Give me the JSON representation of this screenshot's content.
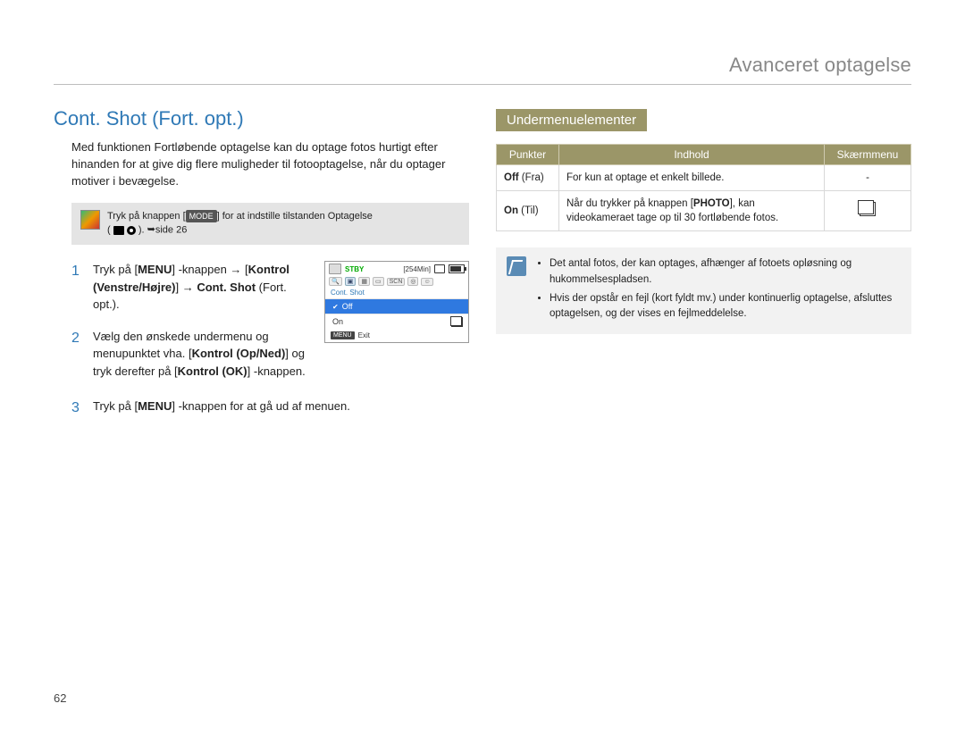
{
  "header": {
    "title": "Avanceret optagelse"
  },
  "section": {
    "title": "Cont. Shot (Fort. opt.)",
    "intro": "Med funktionen Fortløbende optagelse kan du optage fotos hurtigt efter hinanden for at give dig flere muligheder til fotooptagelse, når du optager motiver i bevægelse."
  },
  "note": {
    "pre": "Tryk på knappen [",
    "mode": "MODE",
    "mid": "] for at indstille tilstanden Optagelse",
    "line2_prefix": "( ",
    "line2_suffix": " ). ",
    "page_ref": "side 26"
  },
  "steps": [
    {
      "num": "1",
      "parts": {
        "a": "Tryk på [",
        "b": "MENU",
        "c": "] -knappen ",
        "d": "[",
        "e": "Kontrol (Venstre/Højre)",
        "f": "] ",
        "g": "Cont. Shot",
        "h": " (Fort. opt.)."
      }
    },
    {
      "num": "2",
      "parts": {
        "a": "Vælg den ønskede undermenu og menupunktet vha. [",
        "b": "Kontrol (Op/Ned)",
        "c": "] og tryk derefter på [",
        "d": "Kontrol (OK)",
        "e": "] -knappen."
      }
    },
    {
      "num": "3",
      "parts": {
        "a": "Tryk på [",
        "b": "MENU",
        "c": "] -knappen for at gå ud af menuen."
      }
    }
  ],
  "screen": {
    "stby": "STBY",
    "time": "[254Min]",
    "menu_title": "Cont. Shot",
    "row_off": "Off",
    "row_on": "On",
    "footer_chip": "MENU",
    "footer_text": "Exit"
  },
  "submenu": {
    "title": "Undermenuelementer",
    "headers": {
      "points": "Punkter",
      "content": "Indhold",
      "screen": "Skærmmenu"
    },
    "rows": [
      {
        "point_bold": "Off",
        "point_paren": " (Fra)",
        "content": "For kun at optage et enkelt billede.",
        "screen_dash": "-"
      },
      {
        "point_bold": "On",
        "point_paren": " (Til)",
        "content_a": "Når du trykker på knappen [",
        "content_b": "PHOTO",
        "content_c": "], kan videokameraet tage op til 30 fortløbende fotos."
      }
    ]
  },
  "tip": {
    "bullets": [
      "Det antal fotos, der kan optages, afhænger af fotoets opløsning og hukommelsespladsen.",
      "Hvis der opstår en fejl (kort fyldt mv.) under kontinuerlig optagelse, afsluttes optagelsen, og der vises en fejlmeddelelse."
    ]
  },
  "page_number": "62"
}
